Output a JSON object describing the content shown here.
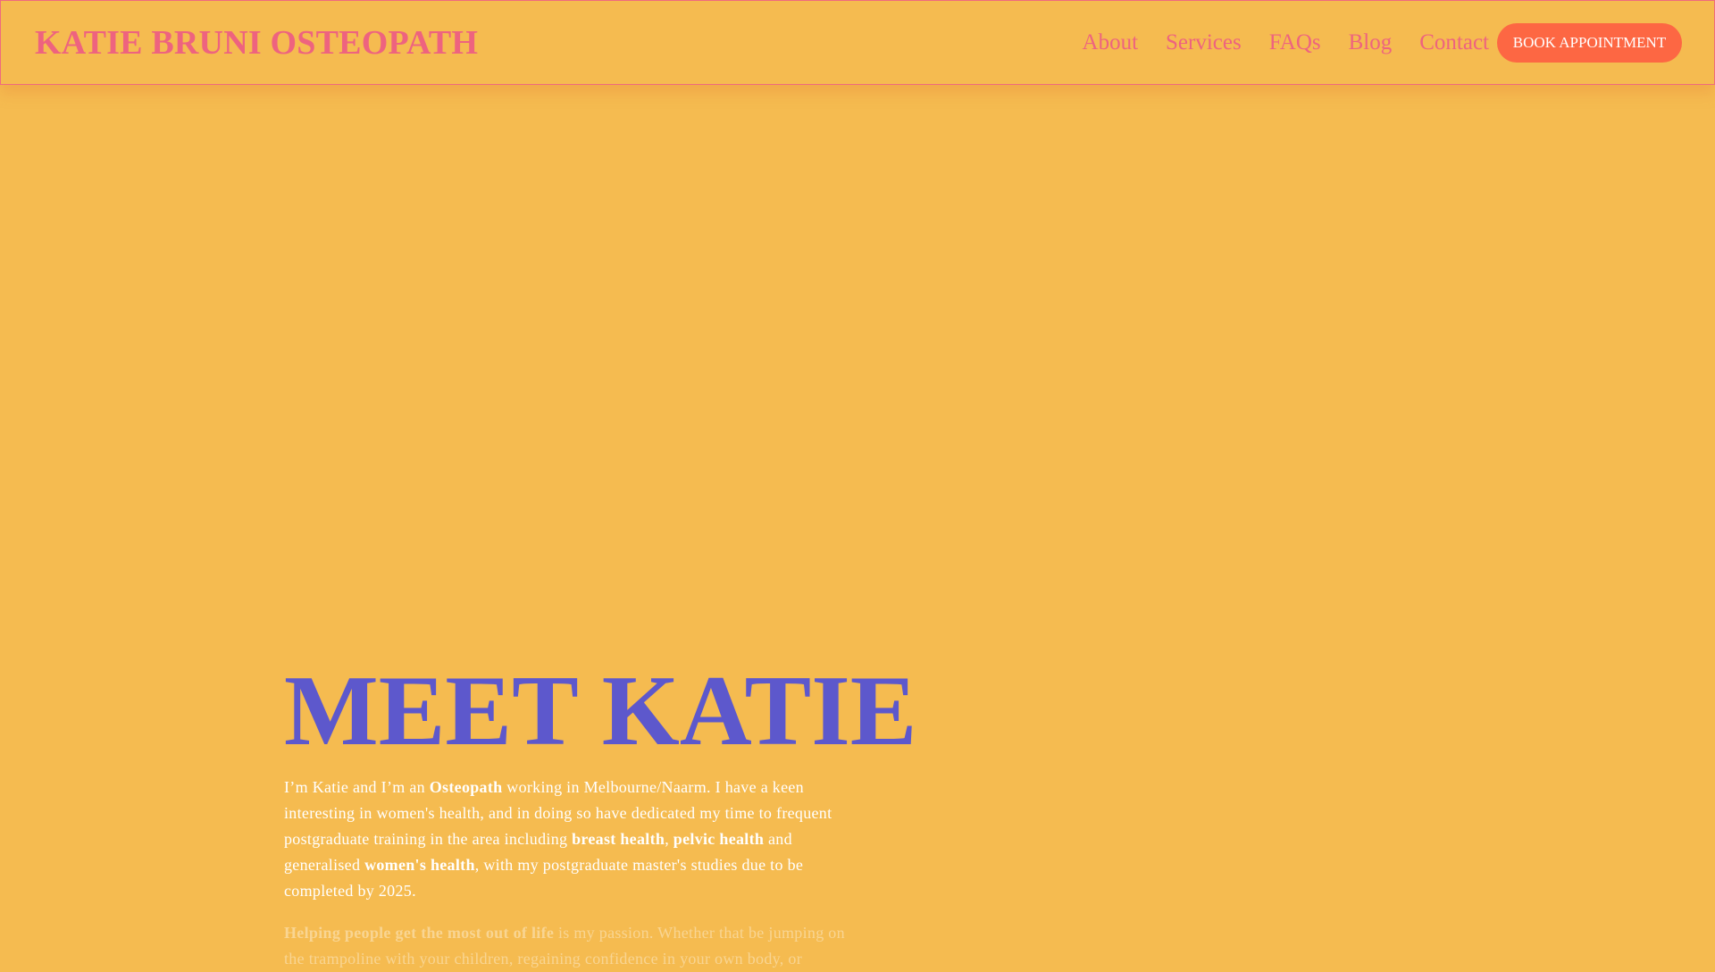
{
  "header": {
    "brand": "KATIE BRUNI OSTEOPATH",
    "nav": [
      "About",
      "Services",
      "FAQs",
      "Blog",
      "Contact"
    ],
    "book_label": "BOOK APPOINTMENT"
  },
  "hero": {
    "heading": "MEET KATIE",
    "intro": [
      "I’m Katie and I’m an ",
      "Osteopath",
      " working in Melbourne/Naarm. I have a keen interesting in women's health, and in doing so have dedicated my time to frequent postgraduate training in the area including ",
      "breast health",
      ", ",
      "pelvic health",
      " and generalised ",
      "women's health",
      ", with my postgraduate master's studies due to be completed by 2025."
    ],
    "passion": [
      "Helping people get the most out of life",
      " is my passion. Whether that be jumping on the trampoline with your children, regaining confidence in your own body, or"
    ]
  },
  "colors": {
    "background": "#f5bb50",
    "brand": "#ee637f",
    "button": "#fd6743",
    "heading": "#5d58cc"
  }
}
